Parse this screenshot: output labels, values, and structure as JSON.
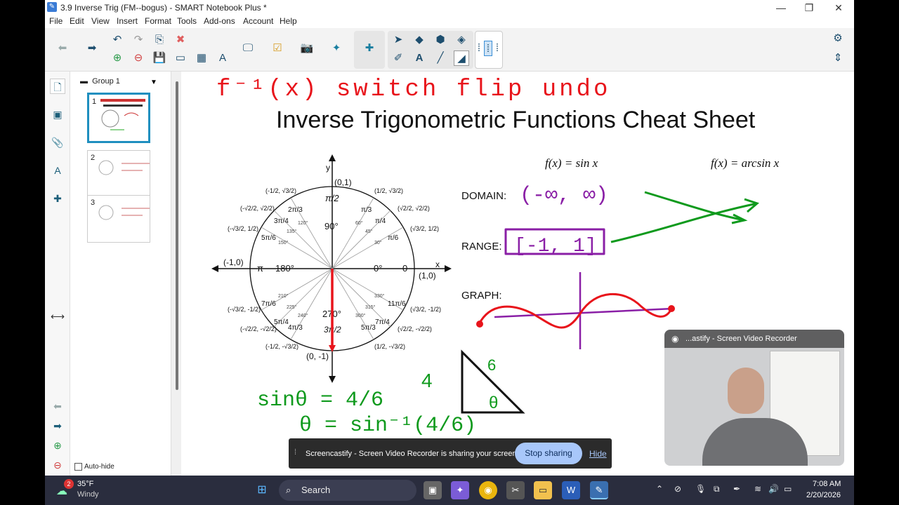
{
  "window": {
    "title": "3.9 Inverse Trig (FM--bogus) - SMART Notebook Plus *"
  },
  "menu": [
    "File",
    "Edit",
    "View",
    "Insert",
    "Format",
    "Tools",
    "Add-ons",
    "Account",
    "Help"
  ],
  "sorter": {
    "group_label": "Group 1",
    "pages": [
      "1",
      "2",
      "3"
    ]
  },
  "autohide_label": "Auto-hide",
  "page": {
    "handwritten_top": "f⁻¹(x)   switch   flip   undo",
    "heading": "Inverse Trigonometric Functions Cheat Sheet",
    "f_sin": "f(x) = sin x",
    "f_arcsin": "f(x) = arcsin x",
    "domain_label": "DOMAIN:",
    "range_label": "RANGE:",
    "graph_label": "GRAPH:",
    "domain_ink": "(-∞, ∞)",
    "range_ink": "[-1, 1]",
    "eq1": "sinθ = 4/6",
    "eq1_side": "4",
    "eq2": "θ = sin⁻¹(4/6)",
    "tri_side": "6",
    "tri_angle": "θ",
    "circle": {
      "y_axis": "y",
      "x_axis": "x",
      "top": "(0,1)",
      "bottom": "(0, -1)",
      "left": "(-1,0)",
      "right": "(1,0)",
      "deg_90": "90°",
      "deg_180": "180°",
      "deg_0": "0°",
      "deg_270": "270°",
      "pi": "π",
      "zero": "0",
      "rad_top": "π/2",
      "rad_bottom": "3π/2",
      "rad_q1": [
        "π/3",
        "π/4",
        "π/6"
      ],
      "rad_q2": [
        "2π/3",
        "3π/4",
        "5π/6"
      ],
      "rad_q3": [
        "7π/6",
        "5π/4",
        "4π/3"
      ],
      "rad_q4": [
        "11π/6",
        "7π/4",
        "5π/3"
      ],
      "deg_small": [
        "60°",
        "45°",
        "30°",
        "120°",
        "135°",
        "150°",
        "210°",
        "225°",
        "240°",
        "300°",
        "315°",
        "330°"
      ],
      "coords": [
        "(1/2, √3/2)",
        "(√2/2, √2/2)",
        "(√3/2, 1/2)",
        "(-1/2, √3/2)",
        "(-√2/2, √2/2)",
        "(-√3/2, 1/2)",
        "(-√3/2, -1/2)",
        "(-√2/2, -√2/2)",
        "(-1/2, -√3/2)",
        "(√3/2, -1/2)",
        "(√2/2, -√2/2)",
        "(1/2, -√3/2)"
      ]
    }
  },
  "recorder": {
    "title": "...astify - Screen Video Recorder"
  },
  "share_bar": {
    "message": "Screencastify - Screen Video Recorder is sharing your screen.",
    "stop": "Stop sharing",
    "hide": "Hide"
  },
  "taskbar": {
    "weather_temp": "35°F",
    "weather_desc": "Windy",
    "badge": "2",
    "search": "Search",
    "time": "7:08 AM",
    "date": "2/20/2026"
  },
  "colors": {
    "ink_red": "#e8141b",
    "ink_green": "#0f9a1d",
    "ink_purple": "#8a1fa6",
    "accent": "#1f8fbf"
  }
}
